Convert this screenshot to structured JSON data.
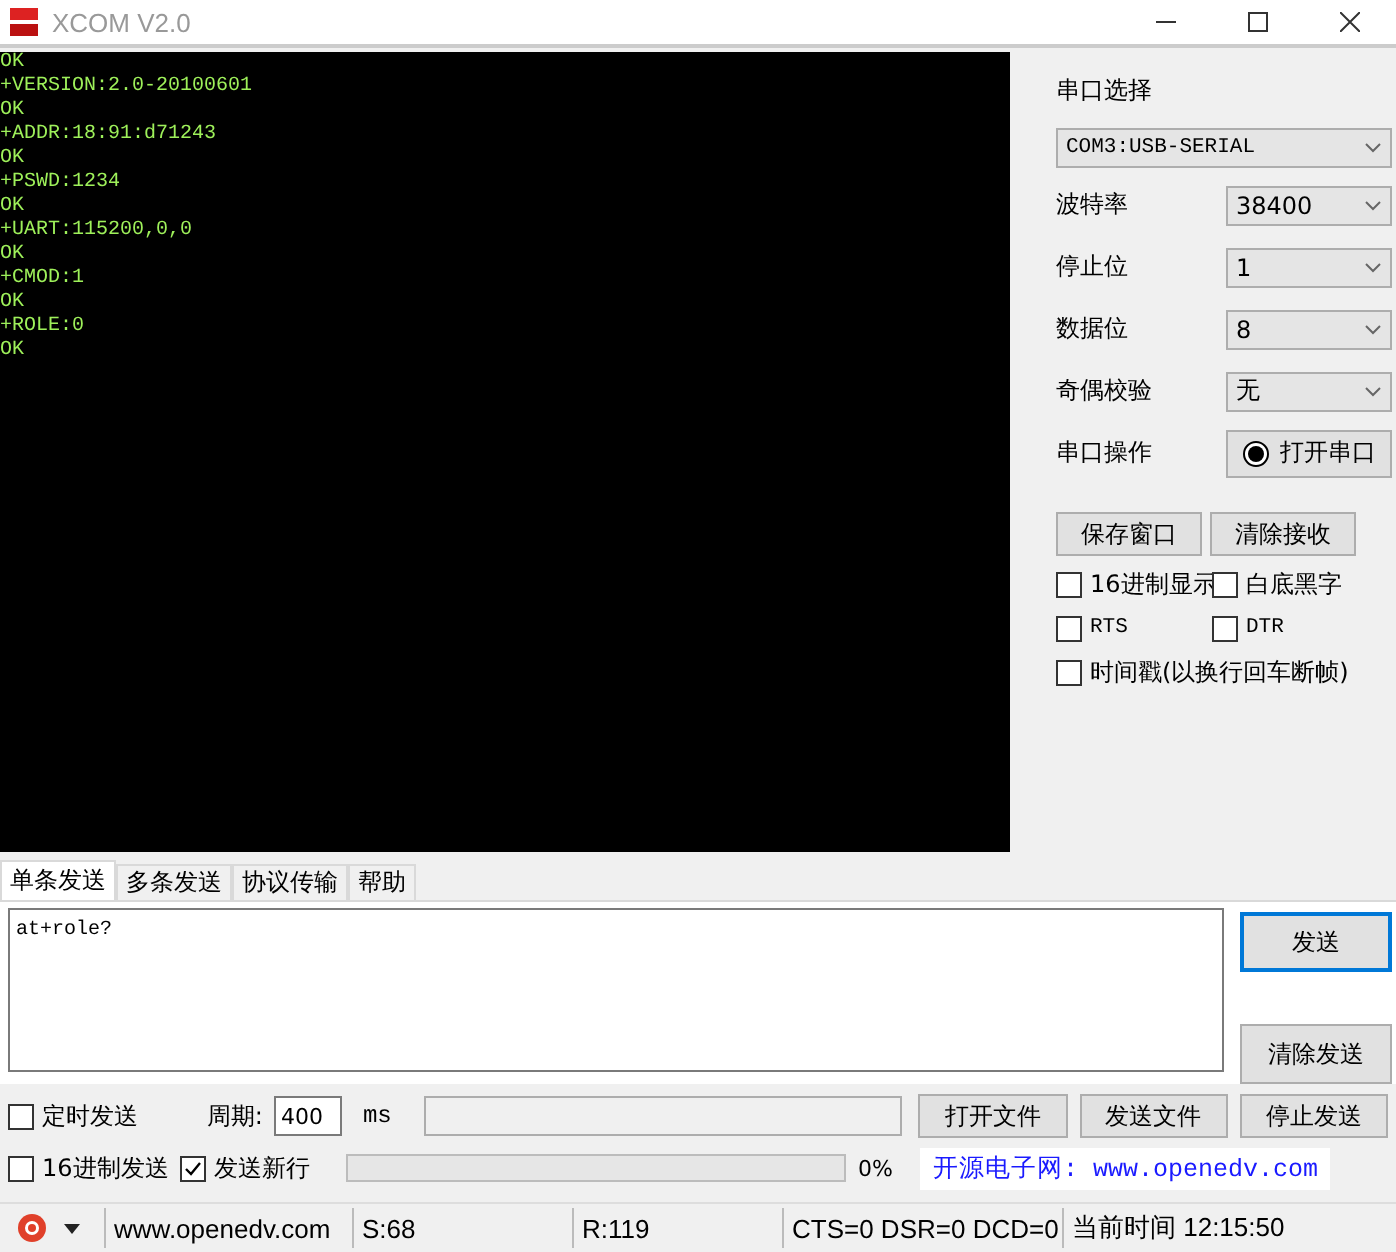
{
  "window": {
    "title": "XCOM V2.0"
  },
  "receive_lines": [
    "OK",
    "+VERSION:2.0-20100601",
    "OK",
    "+ADDR:18:91:d71243",
    "OK",
    "+PSWD:1234",
    "OK",
    "+UART:115200,0,0",
    "OK",
    "+CMOD:1",
    "OK",
    "+ROLE:0",
    "OK"
  ],
  "serial": {
    "port_label": "串口选择",
    "port": "COM3:USB-SERIAL",
    "fields": [
      {
        "label": "波特率",
        "value": "38400"
      },
      {
        "label": "停止位",
        "value": "1"
      },
      {
        "label": "数据位",
        "value": "8"
      },
      {
        "label": "奇偶校验",
        "value": "无"
      }
    ],
    "operation_label": "串口操作",
    "operation_button": "打开串口"
  },
  "receive_buttons": [
    "保存窗口",
    "清除接收"
  ],
  "receive_options": [
    {
      "label": "16进制显示",
      "checked": false
    },
    {
      "label": "白底黑字",
      "checked": false
    },
    {
      "label": "RTS",
      "checked": false
    },
    {
      "label": "DTR",
      "checked": false
    },
    {
      "label": "时间戳(以换行回车断帧)",
      "checked": false
    }
  ],
  "tabs": [
    {
      "label": "单条发送",
      "selected": true
    },
    {
      "label": "多条发送",
      "selected": false
    },
    {
      "label": "协议传输",
      "selected": false
    },
    {
      "label": "帮助",
      "selected": false
    }
  ],
  "send_text": "at+role?",
  "send_buttons": [
    "发送",
    "清除发送"
  ],
  "timed_send": {
    "label": "定时发送",
    "checked": false
  },
  "period": {
    "label": "周期:",
    "value": "400",
    "unit": "ms"
  },
  "file_buttons": [
    "打开文件",
    "发送文件",
    "停止发送"
  ],
  "send_options": [
    {
      "label": "16进制发送",
      "checked": false
    },
    {
      "label": "发送新行",
      "checked": true
    }
  ],
  "progress": {
    "level": 0,
    "reading": "0%"
  },
  "banner": "开源电子网: www.openedv.com",
  "status_bar": [
    "www.openedv.com",
    "S:68",
    "R:119",
    "CTS=0 DSR=0 DCD=0",
    "当前时间 12:15:50"
  ]
}
